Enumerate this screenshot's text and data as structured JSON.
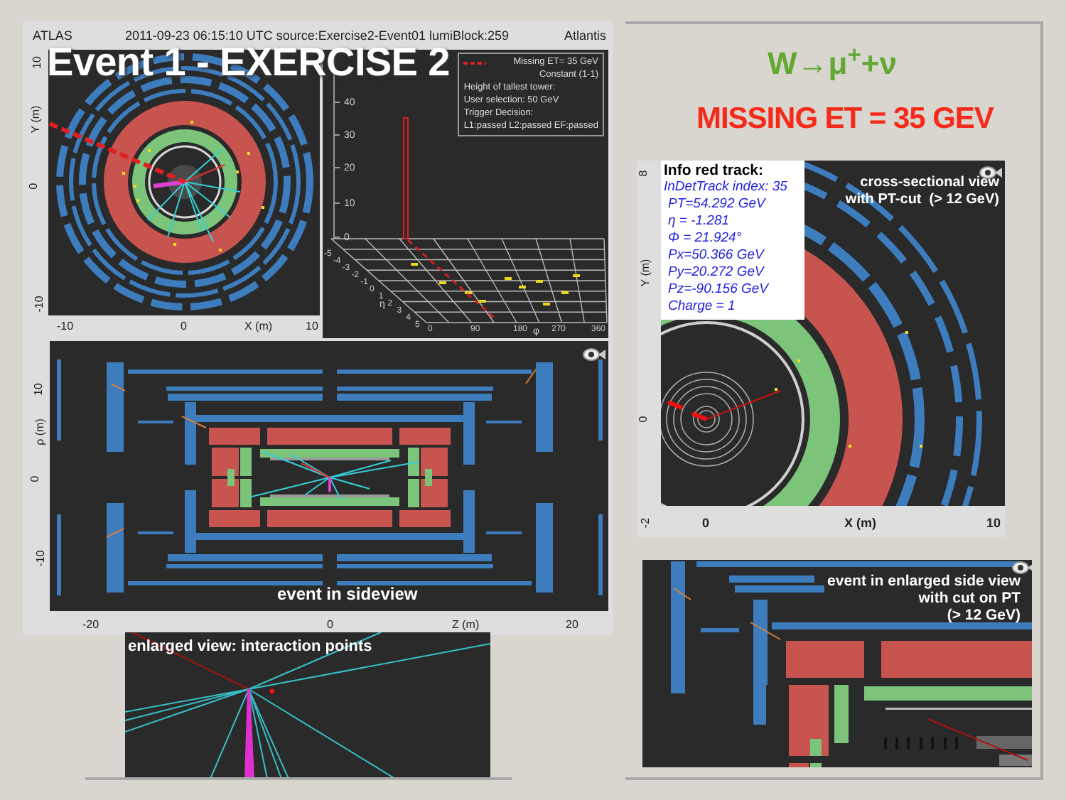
{
  "header": {
    "experiment": "ATLAS",
    "event_info": "2011-09-23 06:15:10 UTC source:Exercise2-Event01 lumiBlock:259",
    "software": "Atlantis"
  },
  "title": "Event 1 - EXERCISE 2",
  "xy_view": {
    "y_ticks": [
      "10",
      "0",
      "-10"
    ],
    "y_label": "Y (m)",
    "x_ticks": [
      "-10",
      "0",
      "10"
    ],
    "x_label": "X (m)"
  },
  "lego_view": {
    "legend": [
      {
        "text": "Missing ET= 35 GeV",
        "kind": "key"
      },
      {
        "text": "Constant (1-1)",
        "kind": "sub"
      },
      {
        "text": "Height of tallest tower:",
        "kind": "text"
      },
      {
        "text": "User selection: 50 GeV",
        "kind": "text"
      },
      {
        "text": "Trigger Decision:",
        "kind": "text"
      },
      {
        "text": "L1:passed L2:passed EF:passed",
        "kind": "text"
      }
    ],
    "height_ticks": [
      "40",
      "30",
      "20",
      "10",
      "0"
    ],
    "eta_ticks": [
      "-5",
      "-4",
      "-3",
      "-2",
      "-1",
      "0",
      "1",
      "2",
      "3",
      "4",
      "5"
    ],
    "eta_label": "η",
    "phi_ticks": [
      "0",
      "90",
      "180",
      "270",
      "360"
    ],
    "phi_label": "φ"
  },
  "side_view": {
    "caption": "event in sideview",
    "y_ticks": [
      "10",
      "0",
      "-10"
    ],
    "y_label": "ρ (m)",
    "x_ticks": [
      "-20",
      "0",
      "20"
    ],
    "x_label": "Z (m)"
  },
  "interaction_view": {
    "caption": "enlarged view: interaction points"
  },
  "decay": "W→μ$^{+}$+ν",
  "missing_et": "MISSING ET = 35 GEV",
  "track_view": {
    "info_title": "Info red track:",
    "info_lines": [
      "InDetTrack index: 35",
      "PT=54.292 GeV",
      "η = -1.281",
      "Φ = 21.924°",
      "Px=50.366 GeV",
      "Py=20.272 GeV",
      "Pz=-90.156 GeV",
      "Charge = 1"
    ],
    "caption_lines": [
      "cross-sectional view",
      "with PT-cut  (> 12 GeV)"
    ],
    "y_ticks": [
      "8",
      "0",
      "-2"
    ],
    "y_label": "Y (m)",
    "x_ticks": [
      "0",
      "10"
    ],
    "x_label": "X (m)"
  },
  "enlarged_side_view": {
    "caption_lines": [
      "event in enlarged side view",
      "with cut on PT",
      "(> 12 GeV)"
    ]
  }
}
